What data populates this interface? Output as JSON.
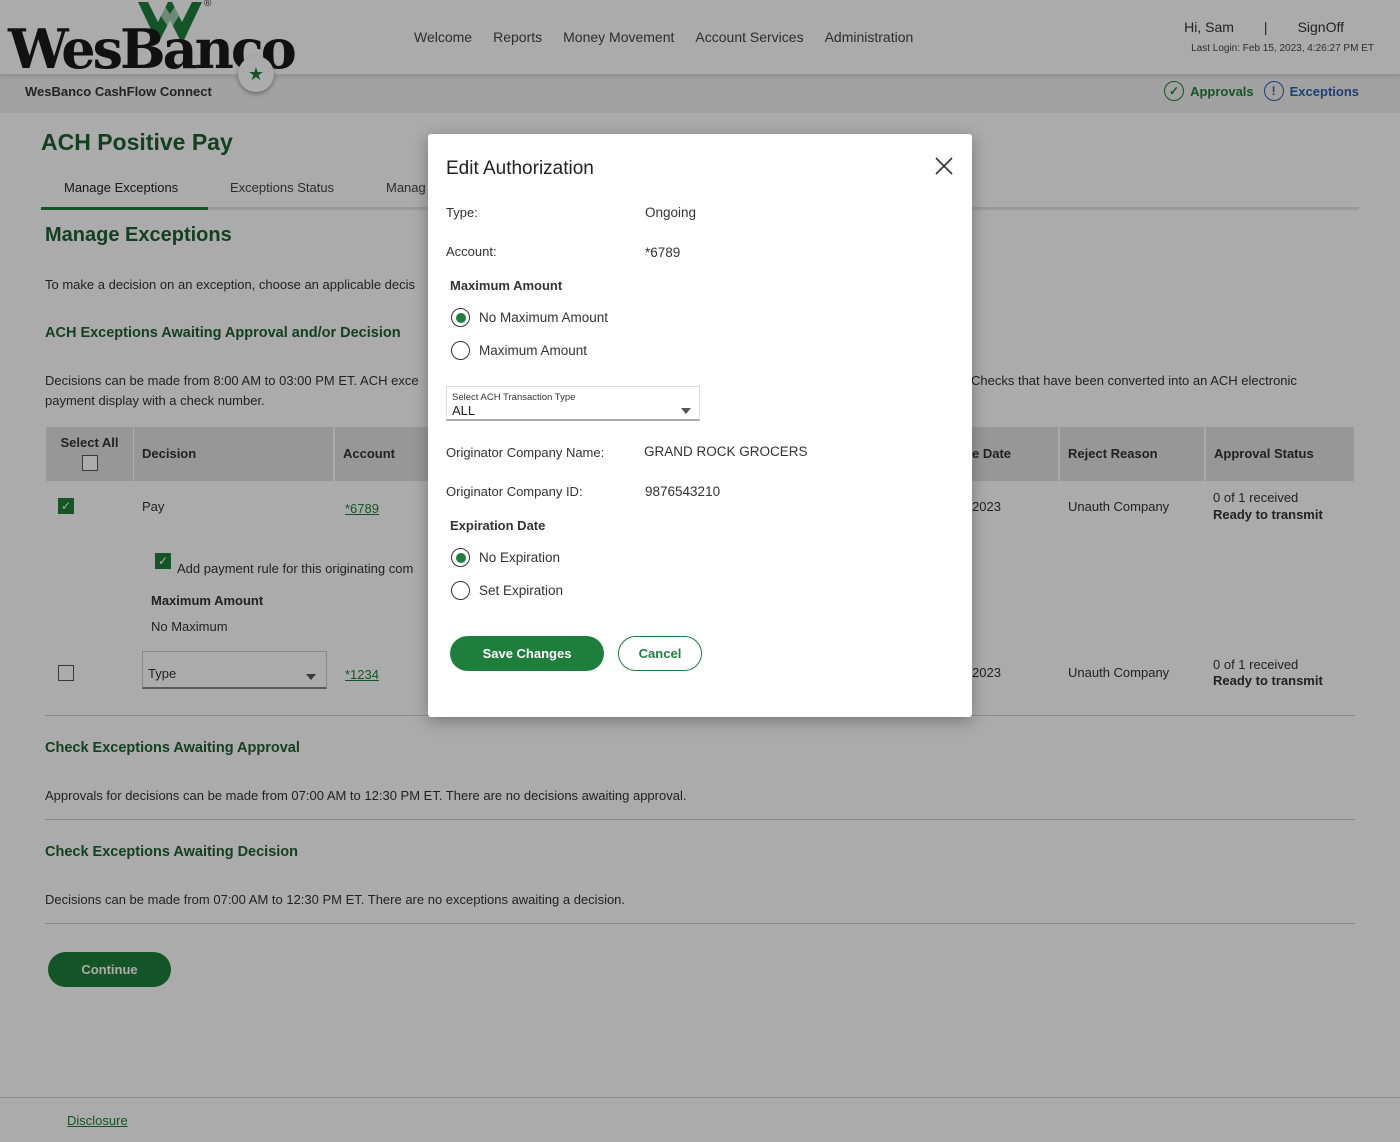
{
  "brand": {
    "logo_text": "WesBanco",
    "logo_reg": "®",
    "product_name": "WesBanco CashFlow Connect",
    "accent_color": "#1e7f3c",
    "heading_color": "#1e5e34",
    "link_blue": "#2b5fb0"
  },
  "nav": {
    "items": [
      "Welcome",
      "Reports",
      "Money Movement",
      "Account Services",
      "Administration"
    ]
  },
  "user": {
    "greeting": "Hi, Sam",
    "separator": "|",
    "signoff": "SignOff",
    "last_login": "Last Login: Feb 15, 2023, 4:26:27 PM ET"
  },
  "quick_links": {
    "approvals": "Approvals",
    "approvals_icon": "check-circle-icon",
    "exceptions": "Exceptions",
    "exceptions_icon": "exclamation-circle-icon"
  },
  "page": {
    "title": "ACH Positive Pay",
    "tabs": [
      "Manage Exceptions",
      "Exceptions Status",
      "Manag"
    ],
    "section_title": "Manage Exceptions",
    "intro": "To make a decision on an exception, choose an applicable decis",
    "ach_heading": "ACH Exceptions Awaiting Approval and/or Decision",
    "ach_desc_left": "Decisions can be made from 8:00 AM to 03:00 PM ET. ACH exce",
    "ach_desc_right": "Checks that have been converted into an ACH electronic",
    "ach_desc_line2": "payment display with a check number."
  },
  "table": {
    "headers": {
      "select_all": "Select All",
      "decision": "Decision",
      "account": "Account",
      "date": "e Date",
      "reject_reason": "Reject Reason",
      "approval_status": "Approval Status"
    },
    "rows": [
      {
        "decision": "Pay",
        "account": "*6789",
        "date": "2023",
        "reject_reason": "Unauth Company",
        "status_count": "0 of 1 received",
        "status": "Ready to transmit"
      },
      {
        "decision": "Type",
        "account": "*1234",
        "date": "2023",
        "reject_reason": "Unauth Company",
        "status_count": "0 of 1 received",
        "status": "Ready to transmit"
      }
    ],
    "rule": {
      "label": "Add payment rule for this originating com",
      "max_label": "Maximum Amount",
      "max_value": "No Maximum"
    }
  },
  "check_approval": {
    "heading": "Check Exceptions Awaiting Approval",
    "text": "Approvals for decisions can be made from 07:00 AM to 12:30 PM ET. There are no decisions awaiting approval."
  },
  "check_decision": {
    "heading": "Check Exceptions Awaiting Decision",
    "text": "Decisions can be made from 07:00 AM to 12:30 PM ET. There are no exceptions awaiting a decision."
  },
  "continue_label": "Continue",
  "footer": {
    "disclosure": "Disclosure"
  },
  "modal": {
    "title": "Edit Authorization",
    "type_label": "Type:",
    "type_value": "Ongoing",
    "account_label": "Account:",
    "account_value": "*6789",
    "max_heading": "Maximum Amount",
    "max_options": [
      "No Maximum Amount",
      "Maximum Amount"
    ],
    "max_selected": "No Maximum Amount",
    "ach_type_label": "Select ACH Transaction Type",
    "ach_type_value": "ALL",
    "orig_name_label": "Originator Company Name:",
    "orig_name_value": "GRAND ROCK GROCERS",
    "orig_id_label": "Originator Company ID:",
    "orig_id_value": "9876543210",
    "exp_heading": "Expiration Date",
    "exp_options": [
      "No Expiration",
      "Set Expiration"
    ],
    "exp_selected": "No Expiration",
    "save_label": "Save Changes",
    "cancel_label": "Cancel"
  }
}
